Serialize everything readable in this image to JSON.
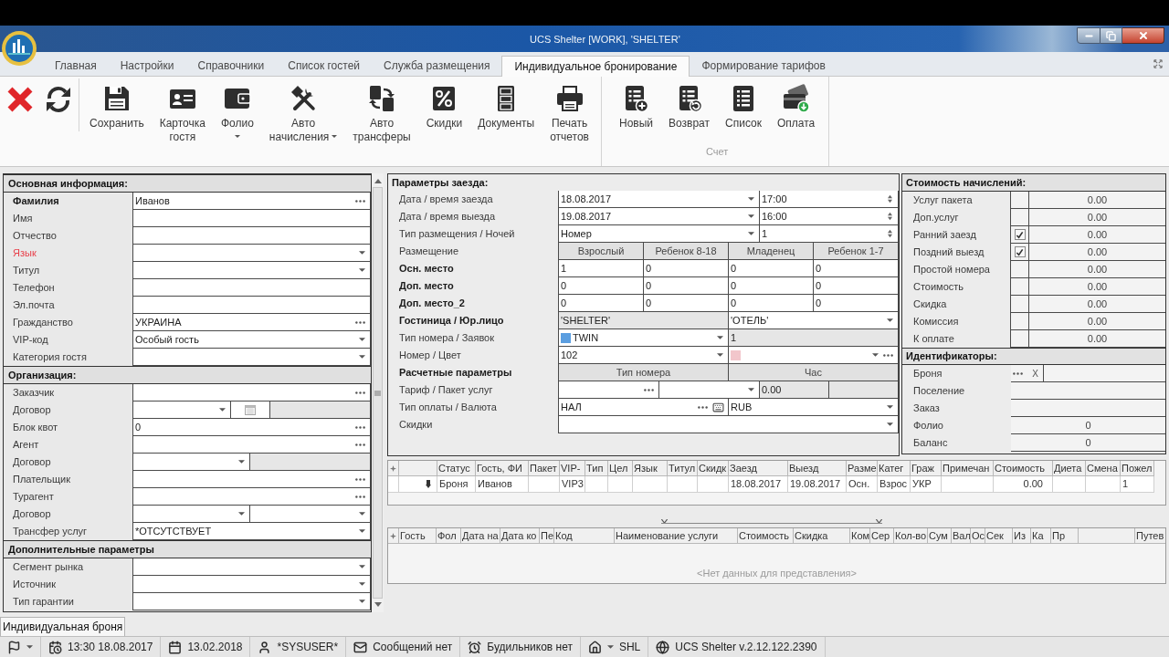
{
  "window": {
    "title": "UCS Shelter [WORK], 'SHELTER'"
  },
  "ribbon": {
    "tabs": [
      {
        "label": "Главная",
        "selected": false
      },
      {
        "label": "Настройки",
        "selected": false
      },
      {
        "label": "Справочники",
        "selected": false
      },
      {
        "label": "Список гостей",
        "selected": false
      },
      {
        "label": "Служба размещения",
        "selected": false
      },
      {
        "label": "Индивидуальное бронирование",
        "selected": true
      },
      {
        "label": "Формирование тарифов",
        "selected": false
      }
    ],
    "groups": [
      {
        "buttons": [
          {
            "label": "Сохранить",
            "dropdown": false
          },
          {
            "label": "Карточка\nгостя",
            "dropdown": false
          },
          {
            "label": "Фолио",
            "dropdown": true
          },
          {
            "label": "Авто\nначисления",
            "dropdown": true
          },
          {
            "label": "Авто\nтрансферы",
            "dropdown": false
          },
          {
            "label": "Скидки",
            "dropdown": false
          },
          {
            "label": "Документы",
            "dropdown": false
          },
          {
            "label": "Печать\nотчетов",
            "dropdown": false
          }
        ]
      },
      {
        "title": "Счет",
        "buttons": [
          {
            "label": "Новый",
            "dropdown": false
          },
          {
            "label": "Возврат",
            "dropdown": false
          },
          {
            "label": "Список",
            "dropdown": false
          },
          {
            "label": "Оплата",
            "dropdown": false
          }
        ]
      }
    ]
  },
  "guest_form": {
    "sections": [
      {
        "title": "Основная информация:",
        "rows": [
          {
            "label": "Фамилия",
            "bold": true,
            "error": false,
            "kind": "lookup",
            "value": "Иванов"
          },
          {
            "label": "Имя",
            "bold": false,
            "error": false,
            "kind": "text"
          },
          {
            "label": "Отчество",
            "bold": false,
            "error": false,
            "kind": "text"
          },
          {
            "label": "Язык",
            "bold": false,
            "error": true,
            "kind": "dropdown"
          },
          {
            "label": "Титул",
            "bold": false,
            "error": false,
            "kind": "dropdown"
          },
          {
            "label": "Телефон",
            "bold": false,
            "error": false,
            "kind": "text"
          },
          {
            "label": "Эл.почта",
            "bold": false,
            "error": false,
            "kind": "text"
          },
          {
            "label": "Гражданство",
            "bold": false,
            "error": false,
            "kind": "lookup",
            "value": "УКРАИНА"
          },
          {
            "label": "VIP-код",
            "bold": false,
            "error": false,
            "kind": "dropdown",
            "value": "Особый гость"
          },
          {
            "label": "Категория гостя",
            "bold": false,
            "error": false,
            "kind": "dropdown"
          }
        ]
      },
      {
        "title": "Организация:",
        "rows": [
          {
            "label": "Заказчик",
            "bold": false,
            "error": false,
            "kind": "lookup"
          },
          {
            "label": "Договор",
            "bold": false,
            "error": false,
            "kind": "contract_calendar"
          },
          {
            "label": "Блок квот",
            "bold": false,
            "error": false,
            "kind": "lookup",
            "value": "0"
          },
          {
            "label": "Агент",
            "bold": false,
            "error": false,
            "kind": "lookup"
          },
          {
            "label": "Договор",
            "bold": false,
            "error": false,
            "kind": "contract"
          },
          {
            "label": "Плательщик",
            "bold": false,
            "error": false,
            "kind": "lookup"
          },
          {
            "label": "Турагент",
            "bold": false,
            "error": false,
            "kind": "lookup"
          },
          {
            "label": "Договор",
            "bold": false,
            "error": false,
            "kind": "double_dropdown"
          },
          {
            "label": "Трансфер услуг",
            "bold": false,
            "error": false,
            "kind": "dropdown",
            "value": "*ОТСУТСТВУЕТ"
          }
        ]
      },
      {
        "title": "Дополнительные параметры",
        "rows": [
          {
            "label": "Сегмент рынка",
            "bold": false,
            "error": false,
            "kind": "dropdown"
          },
          {
            "label": "Источник",
            "bold": false,
            "error": false,
            "kind": "dropdown"
          },
          {
            "label": "Тип гарантии",
            "bold": false,
            "error": false,
            "kind": "dropdown"
          }
        ]
      }
    ]
  },
  "stay_form": {
    "title": "Параметры заезда:",
    "rows": [
      {
        "kind": "pair",
        "label": "Дата / время заезда",
        "bold": false,
        "value": "18.08.2017",
        "value2": "17:00"
      },
      {
        "kind": "pair",
        "label": "Дата / время выезда",
        "bold": false,
        "value": "19.08.2017",
        "value2": "16:00"
      },
      {
        "kind": "pair",
        "label": "Тип размещения / Ночей",
        "bold": false,
        "value": "Номер",
        "value2": "1"
      },
      {
        "kind": "columns",
        "label": "Размещение",
        "bold": false,
        "columns": [
          "Взрослый",
          "Ребенок 8-18",
          "Младенец",
          "Ребенок 1-7"
        ]
      },
      {
        "kind": "counts",
        "label": "Осн. место",
        "bold": true,
        "values": [
          "1",
          "0",
          "0",
          "0"
        ]
      },
      {
        "kind": "counts",
        "label": "Доп. место",
        "bold": true,
        "values": [
          "0",
          "0",
          "0",
          "0"
        ]
      },
      {
        "kind": "counts",
        "label": "Доп. место_2",
        "bold": true,
        "values": [
          "0",
          "0",
          "0",
          "0"
        ]
      },
      {
        "kind": "hotel",
        "label": "Гостиница / Юр.лицо",
        "bold": true,
        "value": "'SHELTER'",
        "value2": "'ОТЕЛЬ'"
      },
      {
        "kind": "room_type",
        "label": "Тип номера / Заявок",
        "bold": false,
        "color": "#5b9ee0",
        "value": "TWIN",
        "value2": "1"
      },
      {
        "kind": "room_color",
        "label": "Номер / Цвет",
        "bold": false,
        "value": "102",
        "color": "#f2c6cb"
      },
      {
        "kind": "columns",
        "label": "Расчетные параметры",
        "bold": true,
        "columns": [
          "Тип номера",
          "Час"
        ]
      },
      {
        "kind": "tariff",
        "label": "Тариф / Пакет услуг",
        "bold": false,
        "amount": "0.00"
      },
      {
        "kind": "payment",
        "label": "Тип оплаты / Валюта",
        "bold": false,
        "value": "НАЛ",
        "value2": "RUB"
      },
      {
        "kind": "dropdown",
        "label": "Скидки",
        "bold": false
      }
    ]
  },
  "charges": {
    "title": "Стоимость начислений:",
    "rows": [
      {
        "label": "Услуг пакета",
        "kind": "plain",
        "value": "0.00"
      },
      {
        "label": "Доп.услуг",
        "kind": "plain",
        "value": "0.00"
      },
      {
        "label": "Ранний заезд",
        "kind": "check",
        "checked": true,
        "value": "0.00"
      },
      {
        "label": "Поздний выезд",
        "kind": "check",
        "checked": true,
        "value": "0.00"
      },
      {
        "label": "Простой номера",
        "kind": "plain",
        "value": "0.00"
      },
      {
        "label": "Стоимость",
        "kind": "plain",
        "value": "0.00"
      },
      {
        "label": "Скидка",
        "kind": "plain",
        "value": "0.00"
      },
      {
        "label": "Комиссия",
        "kind": "plain",
        "value": "0.00"
      },
      {
        "label": "К оплате",
        "kind": "plain",
        "value": "0.00"
      }
    ]
  },
  "identifiers": {
    "title": "Идентификаторы:",
    "rows": [
      {
        "label": "Броня",
        "kind": "lookup_clear",
        "clear": "X"
      },
      {
        "label": "Поселение",
        "kind": "plain"
      },
      {
        "label": "Заказ",
        "kind": "plain"
      },
      {
        "label": "Фолио",
        "kind": "plain",
        "value": "0"
      },
      {
        "label": "Баланс",
        "kind": "plain",
        "value": "0"
      }
    ]
  },
  "bookings_grid": {
    "columns": [
      "Статус",
      "Гость, ФИ",
      "Пакет",
      "VIP-",
      "Тип",
      "Цел",
      "Язык",
      "Титул",
      "Скидк",
      "Заезд",
      "Выезд",
      "Разме",
      "Катег",
      "Граж",
      "Примечан",
      "Стоимость",
      "Диета",
      "Смена",
      "Пожел"
    ],
    "rows": [
      {
        "selected": true,
        "cells": [
          "Броня",
          "Иванов",
          null,
          "VIP3",
          null,
          null,
          null,
          null,
          null,
          "18.08.2017",
          "19.08.2017",
          "Осн.",
          "Взрос",
          "УКР",
          null,
          "0.00",
          null,
          null,
          "1"
        ]
      }
    ]
  },
  "services_grid": {
    "columns": [
      "Гость",
      "Фол",
      "Дата на",
      "Дата ко",
      "Пе",
      "Код",
      "Наименование услуги",
      "Стоимость",
      "Скидка",
      "Ком",
      "Сер",
      "Кол-во",
      "Сум",
      "Вал",
      "Ос",
      "Сек",
      "Из",
      "Ка",
      "Пр",
      null,
      "Путев"
    ],
    "empty_text": "<Нет данных для представления>"
  },
  "document_tabs": [
    {
      "label": "Индивидуальная броня",
      "selected": true
    }
  ],
  "status_bar": {
    "items": [
      {
        "dropdown": true
      },
      {
        "text": "13:30 18.08.2017",
        "dropdown": false
      },
      {
        "text": "13.02.2018",
        "dropdown": false
      },
      {
        "text": "*SYSUSER*",
        "dropdown": false
      },
      {
        "text": "Сообщений нет",
        "dropdown": false
      },
      {
        "text": "Будильников нет",
        "dropdown": false
      },
      {
        "text": "SHL",
        "dropdown": true
      },
      {
        "text": "UCS Shelter v.2.12.122.2390",
        "dropdown": false
      }
    ]
  }
}
